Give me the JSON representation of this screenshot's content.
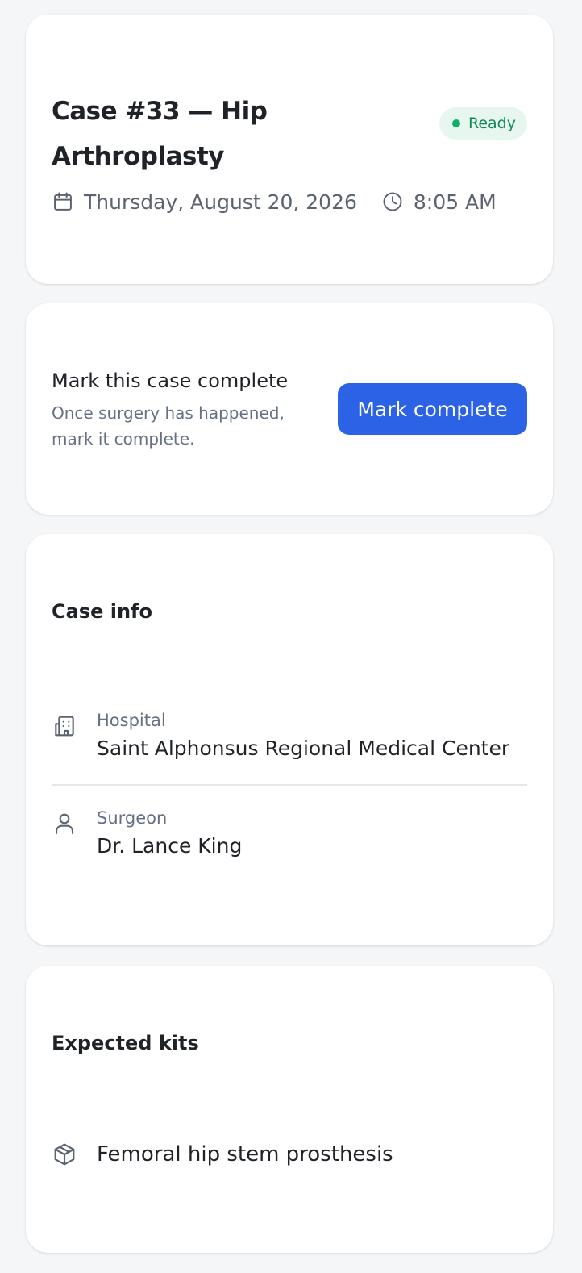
{
  "header": {
    "title": "Case #33 — Hip Arthroplasty",
    "status": "Ready",
    "date": "Thursday, August 20, 2026",
    "time": "8:05 AM"
  },
  "action": {
    "title": "Mark this case complete",
    "description": "Once surgery has happened, mark it complete.",
    "button_label": "Mark complete"
  },
  "case_info": {
    "title": "Case info",
    "hospital_label": "Hospital",
    "hospital_value": "Saint Alphonsus Regional Medical Center",
    "surgeon_label": "Surgeon",
    "surgeon_value": "Dr. Lance King"
  },
  "kits": {
    "title": "Expected kits",
    "items": [
      {
        "name": "Femoral hip stem prosthesis"
      }
    ]
  },
  "icons": {
    "date": "calendar-icon",
    "time": "clock-icon",
    "hospital": "building-icon",
    "surgeon": "user-icon",
    "kit": "package-icon"
  },
  "colors": {
    "accent": "#2b62e6",
    "status_bg": "#e7f7ef",
    "status_text": "#0f8a52",
    "status_dot": "#10b06b"
  }
}
